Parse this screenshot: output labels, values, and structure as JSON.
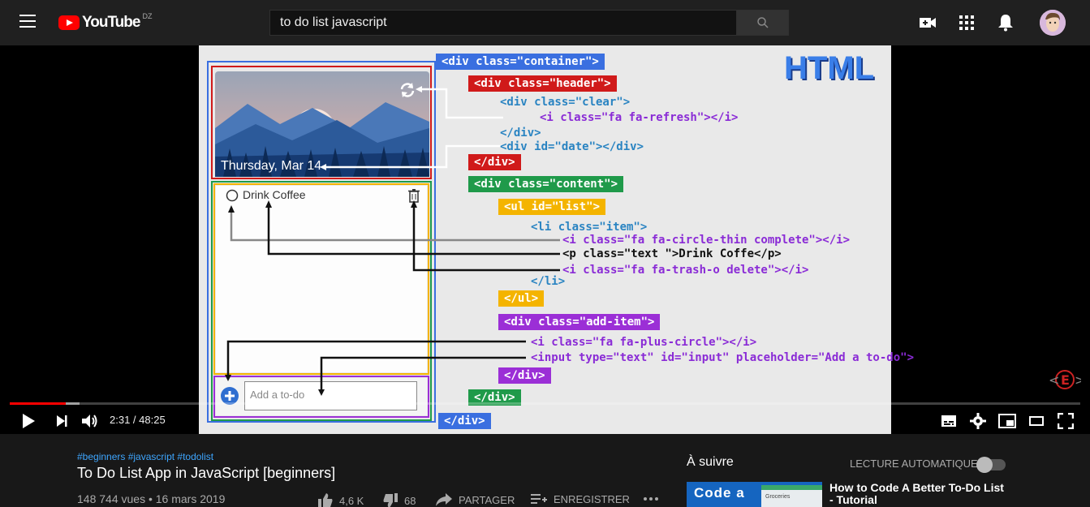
{
  "header": {
    "logo_text": "YouTube",
    "country_code": "DZ",
    "search_value": "to do list javascript"
  },
  "video_content": {
    "app_date": "Thursday, Mar 14",
    "todo_item": "Drink Coffee",
    "add_placeholder": "Add a to-do",
    "html_label": "HTML",
    "code": {
      "container_open": "<div class=\"container\">",
      "header_open": "<div class=\"header\">",
      "clear_open": "<div class=\"clear\">",
      "refresh_icon": "<i class=\"fa fa-refresh\"></i>",
      "clear_close": "</div>",
      "date_div": "<div id=\"date\"></div>",
      "header_close": "</div>",
      "content_open": "<div class=\"content\">",
      "ul_open": "<ul id=\"list\">",
      "li_open": "<li class=\"item\">",
      "circle_icon": "<i class=\"fa fa-circle-thin complete\"></i>",
      "p_text": "<p class=\"text \">Drink Coffe</p>",
      "trash_icon": "<i class=\"fa fa-trash-o delete\"></i>",
      "li_close": "</li>",
      "ul_close": "</ul>",
      "additem_open": "<div class=\"add-item\">",
      "plus_icon": "<i class=\"fa fa-plus-circle\"></i>",
      "input_tag": "<input type=\"text\" id=\"input\" placeholder=\"Add a to-do\">",
      "additem_close": "</div>",
      "content_close": "</div>",
      "container_close": "</div>"
    }
  },
  "player": {
    "time": "2:31 / 48:25",
    "progress_played": 0.052,
    "progress_loaded": 0.065
  },
  "video_info": {
    "tags": "#beginners #javascript #todolist",
    "title": "To Do List App in JavaScript [beginners]",
    "meta": "148 744 vues • 16 mars 2019",
    "likes": "4,6 K",
    "dislikes": "68",
    "share": "PARTAGER",
    "save": "ENREGISTRER"
  },
  "sidebar": {
    "up_next": "À suivre",
    "autoplay": "LECTURE AUTOMATIQUE",
    "next_thumb_text": "Code a",
    "next_thumb_sub": "Groceries",
    "next_title": "How to Code A Better To-Do List - Tutorial"
  },
  "colors": {
    "youtube_red": "#ff0000",
    "link_blue": "#3ea6ff",
    "container_blue": "#3a6fe0",
    "header_red": "#d01a1a",
    "content_green": "#1f9a4a",
    "list_yellow": "#f4b400",
    "additem_purple": "#9b2fd6"
  }
}
